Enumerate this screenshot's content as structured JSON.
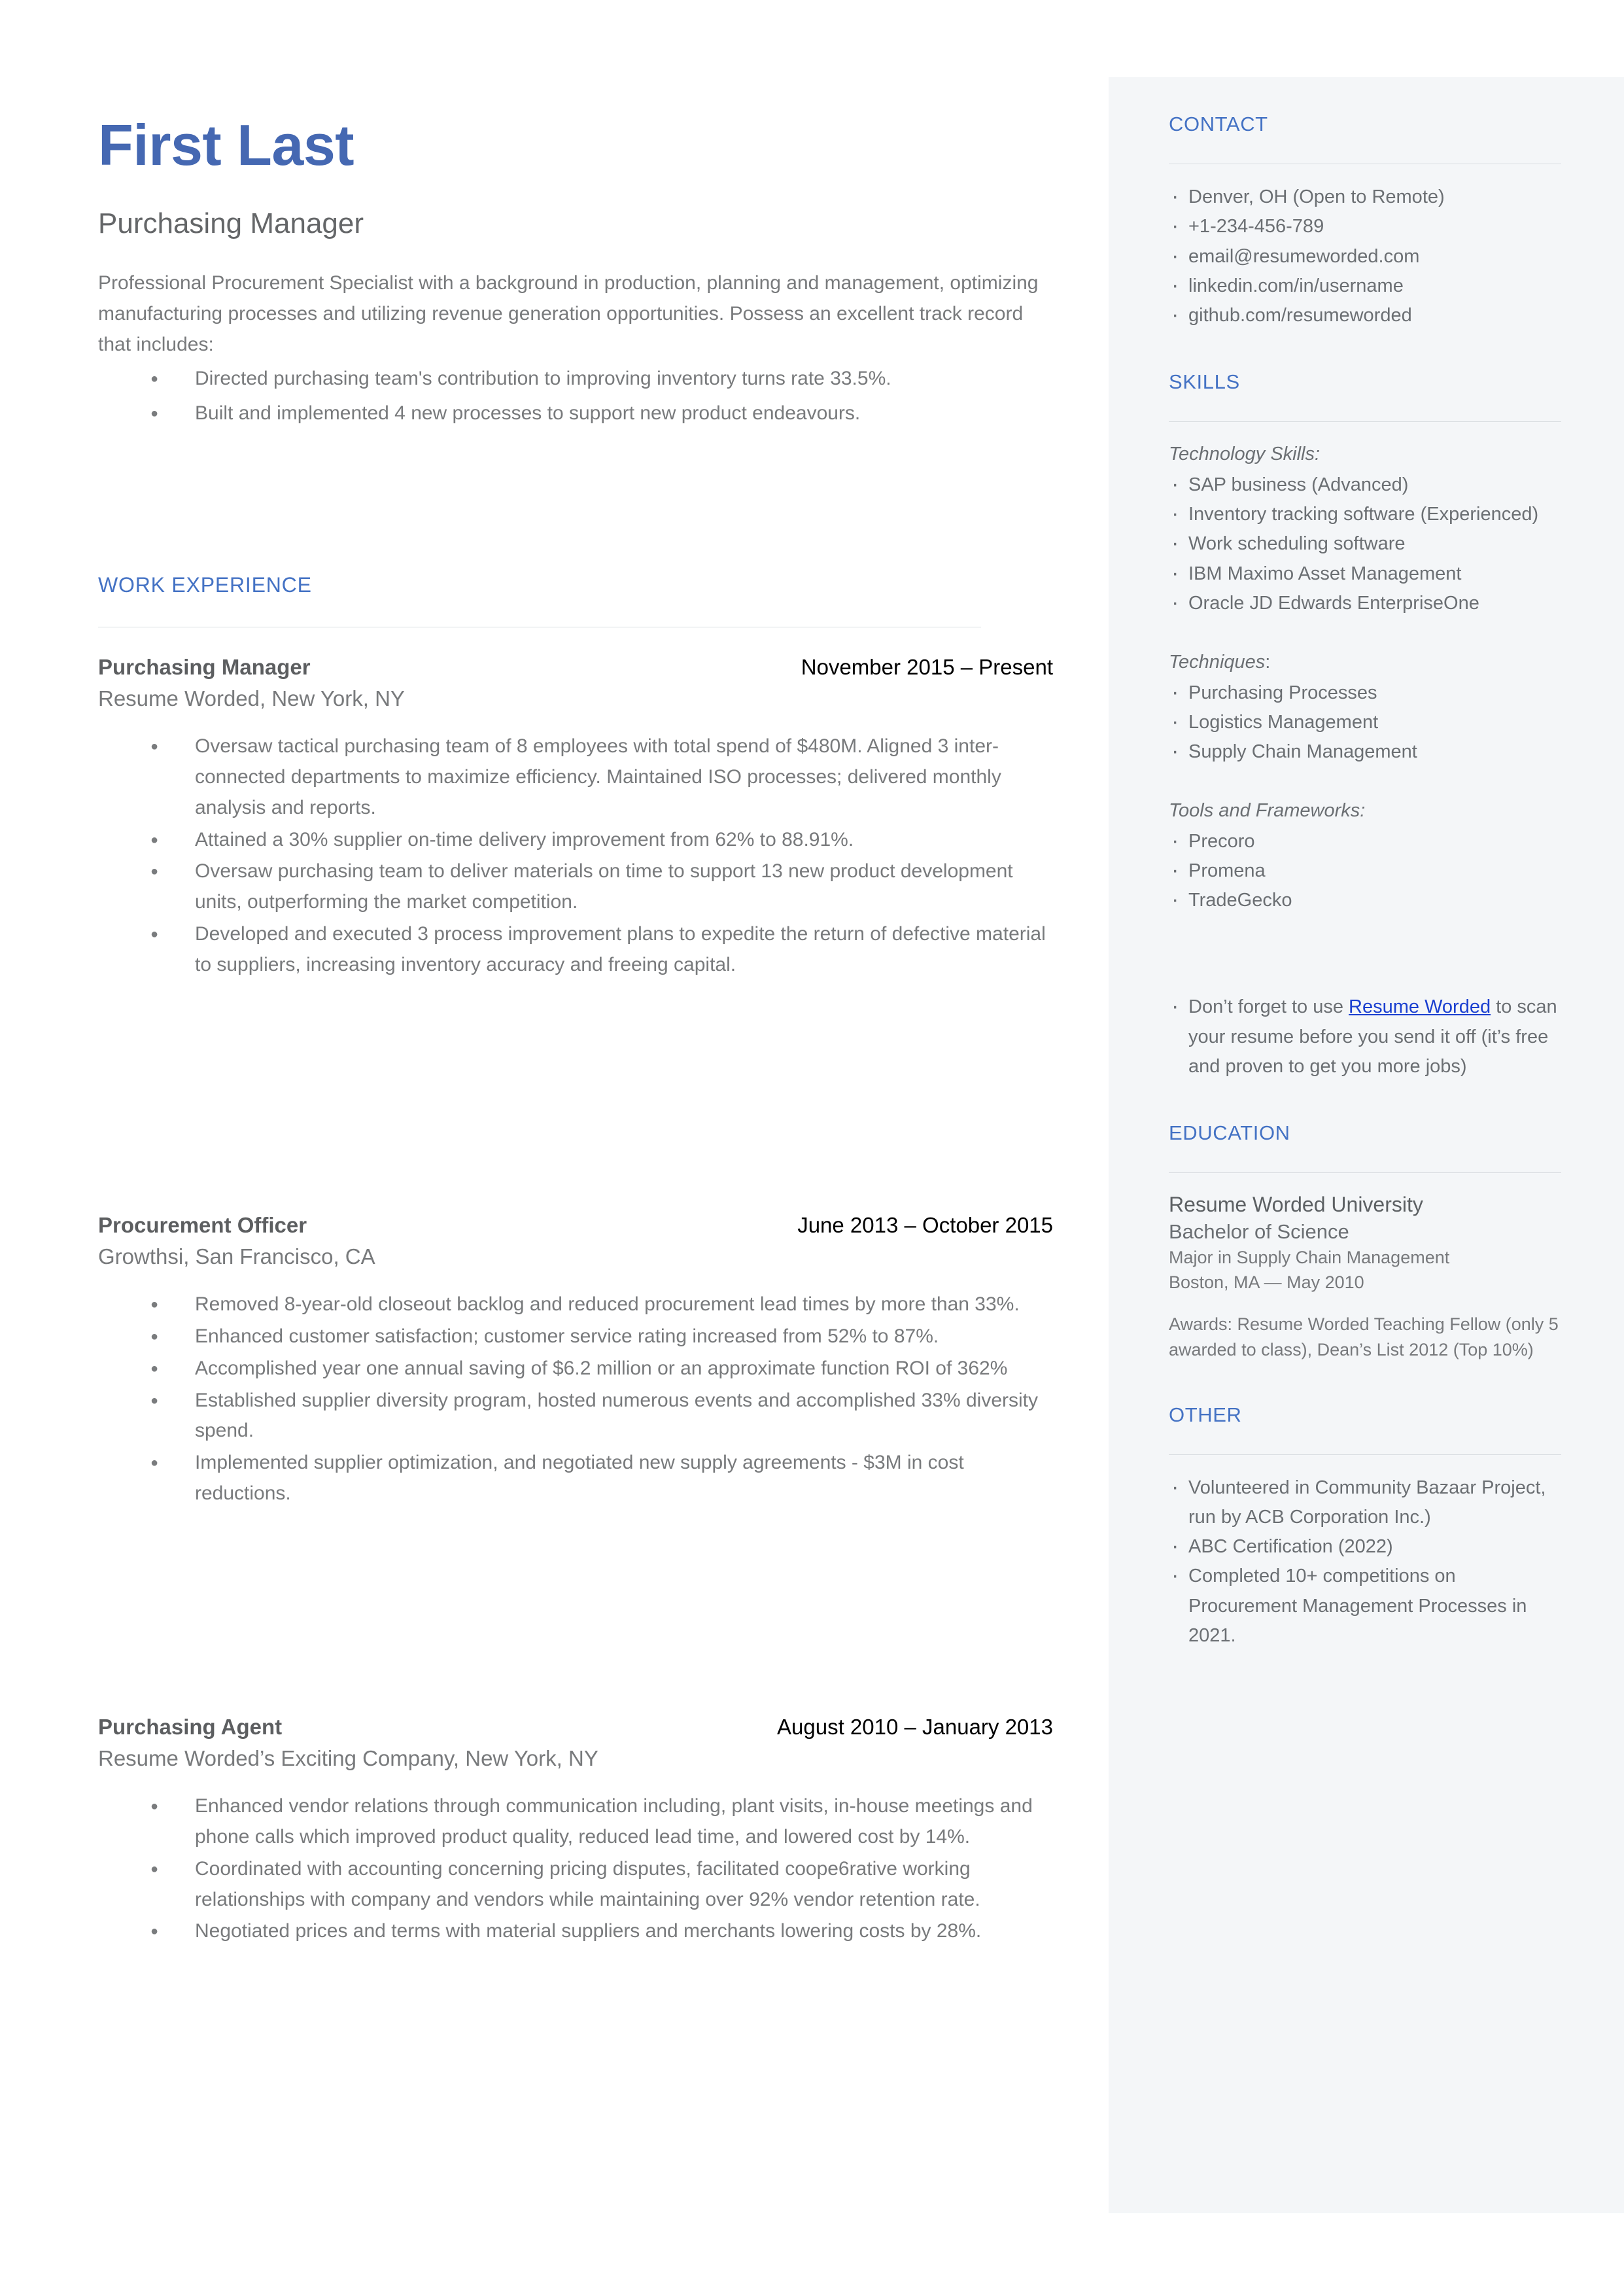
{
  "colors": {
    "name_blue": "#4568b2",
    "heading_blue": "#4472c4",
    "body_grey": "#787a7c",
    "sidebar_bg": "#f4f6f8",
    "link_blue": "#1a3fd0"
  },
  "header": {
    "name": "First Last",
    "headline": "Purchasing Manager",
    "summary_intro": "Professional Procurement Specialist with a background in production, planning and management, optimizing manufacturing processes and utilizing revenue generation opportunities. Possess an excellent track record that includes:",
    "summary_bullets": [
      "Directed purchasing team's contribution to improving inventory turns rate 33.5%.",
      "Built and implemented 4 new processes to support new product endeavours."
    ]
  },
  "work_experience": {
    "heading": "WORK EXPERIENCE",
    "jobs": [
      {
        "title": "Purchasing Manager",
        "dates": "November 2015 – Present",
        "company": "Resume Worded, New York, NY",
        "bullets": [
          "Oversaw tactical purchasing team of 8 employees with total spend of $480M. Aligned 3 inter-connected departments to maximize efficiency. Maintained ISO processes; delivered monthly analysis and reports.",
          "Attained a 30% supplier on-time delivery improvement from 62% to 88.91%.",
          "Oversaw purchasing team to deliver materials on time to support 13 new product development units, outperforming the market competition.",
          "Developed and executed 3 process improvement plans to expedite the return of defective material to suppliers, increasing inventory accuracy and freeing capital."
        ]
      },
      {
        "title": "Procurement Officer",
        "dates": "June 2013 – October 2015",
        "company": "Growthsi, San Francisco, CA",
        "bullets": [
          "Removed 8-year-old closeout backlog and reduced procurement lead times by more than 33%.",
          "Enhanced customer satisfaction; customer service rating increased from 52% to 87%.",
          "Accomplished year one annual saving of $6.2 million or an approximate function ROI of 362%",
          "Established supplier diversity program, hosted numerous events and accomplished 33% diversity spend.",
          "Implemented supplier optimization, and negotiated new supply agreements - $3M in cost reductions."
        ]
      },
      {
        "title": "Purchasing Agent",
        "dates": "August 2010 – January 2013",
        "company": "Resume Worded’s Exciting Company, New York, NY",
        "bullets": [
          "Enhanced vendor relations through communication including, plant visits, in-house meetings and phone calls which improved product quality, reduced lead time, and lowered cost by 14%.",
          "Coordinated with accounting concerning pricing disputes, facilitated coope6rative working relationships with company and vendors while maintaining over 92% vendor retention rate.",
          "Negotiated prices and terms with material suppliers and merchants lowering costs by 28%."
        ]
      }
    ]
  },
  "sidebar": {
    "contact": {
      "heading": "CONTACT",
      "items": [
        "Denver, OH (Open to Remote)",
        "+1-234-456-789",
        "email@resumeworded.com",
        "linkedin.com/in/username",
        "github.com/resumeworded"
      ]
    },
    "skills": {
      "heading": "SKILLS",
      "groups": [
        {
          "label": "Technology Skills:",
          "label_italic": "Technology Skills:",
          "label_tail": "",
          "items": [
            "SAP business (Advanced)",
            "Inventory tracking software (Experienced)",
            "Work scheduling software",
            "IBM Maximo Asset Management",
            "Oracle JD Edwards EnterpriseOne"
          ]
        },
        {
          "label": "Techniques:",
          "label_italic": "Techniques",
          "label_tail": ":",
          "items": [
            "Purchasing Processes",
            "Logistics Management",
            "Supply Chain Management"
          ]
        },
        {
          "label": "Tools and Frameworks:",
          "label_italic": "Tools and Frameworks:",
          "label_tail": "",
          "items": [
            "Precoro",
            "Promena",
            "TradeGecko"
          ]
        }
      ]
    },
    "note": {
      "before_link": "Don’t forget to use ",
      "link_text": "Resume Worded",
      "after_link": " to scan your resume before you send it off (it’s free and proven to get you more jobs)"
    },
    "education": {
      "heading": "EDUCATION",
      "school": "Resume Worded University",
      "degree": "Bachelor of Science",
      "major": "Major in Supply Chain Management",
      "location_date": "Boston, MA — May 2010",
      "awards": "Awards: Resume Worded Teaching Fellow (only 5 awarded to class), Dean’s List 2012 (Top 10%)"
    },
    "other": {
      "heading": "OTHER",
      "items": [
        "Volunteered in Community Bazaar Project, run by ACB Corporation Inc.)",
        "ABC Certification (2022)",
        "Completed 10+ competitions on Procurement Management Processes in 2021."
      ]
    }
  }
}
